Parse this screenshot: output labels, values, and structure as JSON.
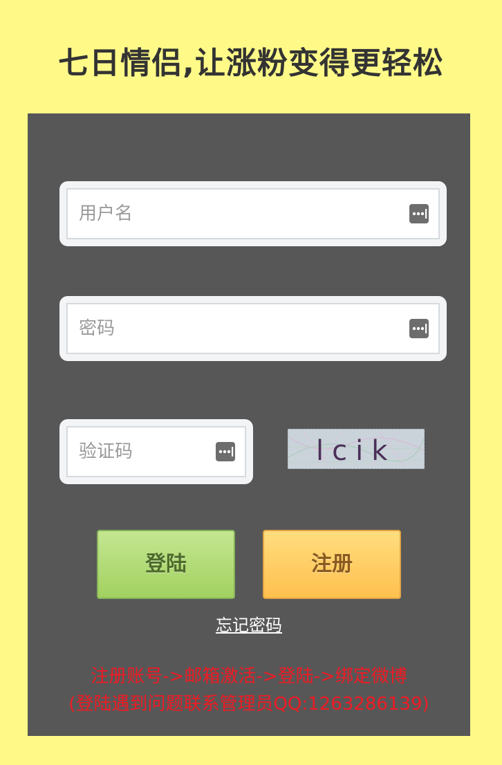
{
  "header": {
    "title": "七日情侣,让涨粉变得更轻松"
  },
  "form": {
    "username_placeholder": "用户名",
    "password_placeholder": "密码",
    "captcha_placeholder": "验证码",
    "captcha_image_text": "lcik",
    "login_label": "登陆",
    "register_label": "注册",
    "forgot_label": "忘记密码"
  },
  "notice": {
    "line1": "注册账号->邮箱激活->登陆->绑定微博",
    "line2": "(登陆遇到问题联系管理员QQ:1263286139)"
  },
  "colors": {
    "page_background": "#fffa88",
    "panel_background": "#575757",
    "login_button": "#b3dc78",
    "register_button": "#ffcc60",
    "notice_text": "#ee1c25"
  },
  "icons": {
    "field_icon": "key-dots-icon"
  }
}
